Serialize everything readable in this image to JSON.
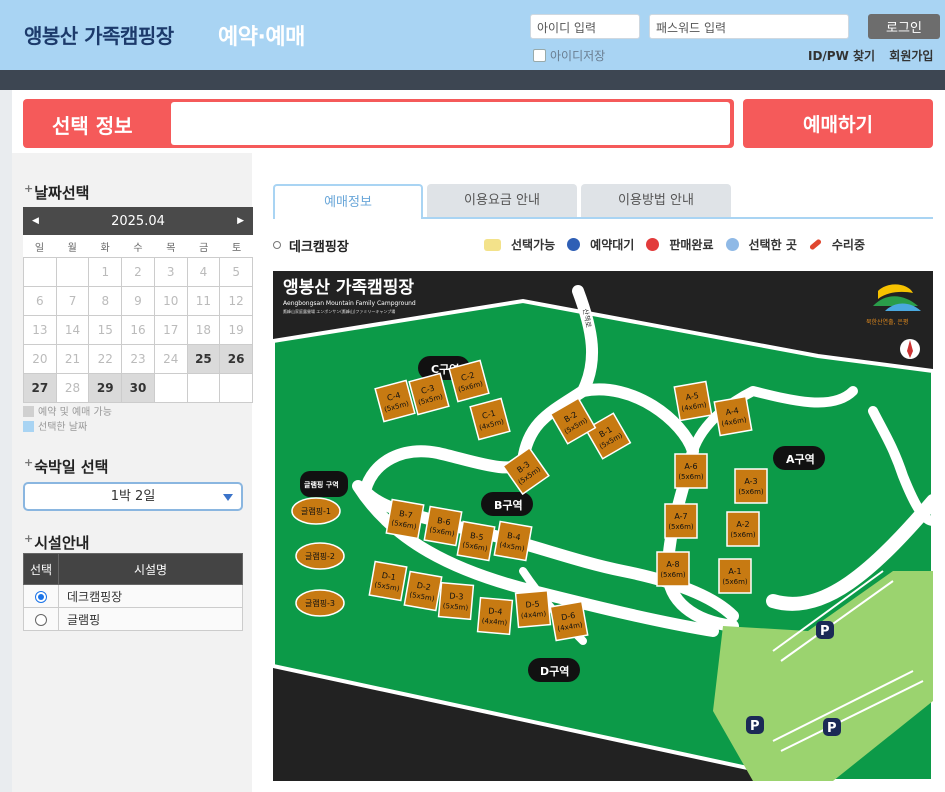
{
  "header": {
    "title": "앵봉산 가족캠핑장",
    "subtitle": "예약·예매",
    "id_placeholder": "아이디 입력",
    "pw_placeholder": "패스워드 입력",
    "login_label": "로그인",
    "save_id_label": "아이디저장",
    "find_label": "ID/PW 찾기",
    "signup_label": "회원가입"
  },
  "selection": {
    "label": "선택 정보",
    "value": "",
    "book_label": "예매하기"
  },
  "date_section": {
    "heading": "날짜선택",
    "month": "2025.04",
    "prev": "◀",
    "next": "▶",
    "weekdays": [
      "일",
      "월",
      "화",
      "수",
      "목",
      "금",
      "토"
    ],
    "cells": [
      {
        "d": "",
        "a": false
      },
      {
        "d": "",
        "a": false
      },
      {
        "d": "1",
        "a": false
      },
      {
        "d": "2",
        "a": false
      },
      {
        "d": "3",
        "a": false
      },
      {
        "d": "4",
        "a": false
      },
      {
        "d": "5",
        "a": false
      },
      {
        "d": "6",
        "a": false
      },
      {
        "d": "7",
        "a": false
      },
      {
        "d": "8",
        "a": false
      },
      {
        "d": "9",
        "a": false
      },
      {
        "d": "10",
        "a": false
      },
      {
        "d": "11",
        "a": false
      },
      {
        "d": "12",
        "a": false
      },
      {
        "d": "13",
        "a": false
      },
      {
        "d": "14",
        "a": false
      },
      {
        "d": "15",
        "a": false
      },
      {
        "d": "16",
        "a": false
      },
      {
        "d": "17",
        "a": false
      },
      {
        "d": "18",
        "a": false
      },
      {
        "d": "19",
        "a": false
      },
      {
        "d": "20",
        "a": false
      },
      {
        "d": "21",
        "a": false
      },
      {
        "d": "22",
        "a": false
      },
      {
        "d": "23",
        "a": false
      },
      {
        "d": "24",
        "a": false
      },
      {
        "d": "25",
        "a": true
      },
      {
        "d": "26",
        "a": true
      },
      {
        "d": "27",
        "a": true
      },
      {
        "d": "28",
        "a": false
      },
      {
        "d": "29",
        "a": true
      },
      {
        "d": "30",
        "a": true
      },
      {
        "d": "",
        "a": false
      },
      {
        "d": "",
        "a": false
      },
      {
        "d": "",
        "a": false
      }
    ],
    "legend_available": "예약 및 예매 가능",
    "legend_selected": "선택한 날짜",
    "legend_available_color": "#d0d0d0",
    "legend_selected_color": "#a9d4f3"
  },
  "nights": {
    "heading": "숙박일 선택",
    "value": "1박 2일"
  },
  "facility": {
    "heading": "시설안내",
    "col_select": "선택",
    "col_name": "시설명",
    "rows": [
      {
        "name": "데크캠핑장",
        "selected": true
      },
      {
        "name": "글램핑",
        "selected": false
      }
    ]
  },
  "tabs": [
    {
      "label": "예매정보",
      "active": true
    },
    {
      "label": "이용요금 안내",
      "active": false
    },
    {
      "label": "이용방법 안내",
      "active": false
    }
  ],
  "map_section": {
    "title": "데크캠핑장",
    "legend": [
      {
        "label": "선택가능",
        "icon": "home-icon",
        "color": "#f3e28a"
      },
      {
        "label": "예약대기",
        "icon": "clock-icon",
        "color": "#2f5fb5"
      },
      {
        "label": "판매완료",
        "icon": "x-circle-icon",
        "color": "#e23b3b"
      },
      {
        "label": "선택한 곳",
        "icon": "check-circle-icon",
        "color": "#8fb9e6"
      },
      {
        "label": "수리중",
        "icon": "wrench-icon",
        "color": "#e0472f"
      }
    ]
  },
  "map": {
    "title": "앵봉산 가족캠핑장",
    "subtitle_en": "Aengbongsan Mountain Family Campground",
    "subtitle_small": "鷹峰山家庭露營場 エンボンサン(鷹峰山)ファミリーキャンプ場",
    "logo_text": "북한산연출, 은평",
    "zones": {
      "a": "A구역",
      "b": "B구역",
      "c": "C구역",
      "d": "D구역",
      "glamping": "글램핑 구역"
    },
    "road_label": "산책로",
    "parking": "P",
    "sites": [
      {
        "name": "C-1",
        "size": "(4x5m)"
      },
      {
        "name": "C-2",
        "size": "(5x6m)"
      },
      {
        "name": "C-3",
        "size": "(5x5m)"
      },
      {
        "name": "C-4",
        "size": "(5x5m)"
      },
      {
        "name": "B-1",
        "size": "(5x5m)"
      },
      {
        "name": "B-2",
        "size": "(5x5m)"
      },
      {
        "name": "B-3",
        "size": "(5x5m)"
      },
      {
        "name": "B-4",
        "size": "(4x5m)"
      },
      {
        "name": "B-5",
        "size": "(5x6m)"
      },
      {
        "name": "B-6",
        "size": "(5x6m)"
      },
      {
        "name": "B-7",
        "size": "(5x6m)"
      },
      {
        "name": "A-1",
        "size": "(5x6m)"
      },
      {
        "name": "A-2",
        "size": "(5x6m)"
      },
      {
        "name": "A-3",
        "size": "(5x6m)"
      },
      {
        "name": "A-4",
        "size": "(4x6m)"
      },
      {
        "name": "A-5",
        "size": "(4x6m)"
      },
      {
        "name": "A-6",
        "size": "(5x6m)"
      },
      {
        "name": "A-7",
        "size": "(5x6m)"
      },
      {
        "name": "A-8",
        "size": "(5x6m)"
      },
      {
        "name": "D-1",
        "size": "(5x5m)"
      },
      {
        "name": "D-2",
        "size": "(5x5m)"
      },
      {
        "name": "D-3",
        "size": "(5x5m)"
      },
      {
        "name": "D-4",
        "size": "(4x4m)"
      },
      {
        "name": "D-5",
        "size": "(4x4m)"
      },
      {
        "name": "D-6",
        "size": "(4x4m)"
      },
      {
        "name": "글램핑-1",
        "size": ""
      },
      {
        "name": "글램핑-2",
        "size": ""
      },
      {
        "name": "글램핑-3",
        "size": ""
      }
    ]
  }
}
